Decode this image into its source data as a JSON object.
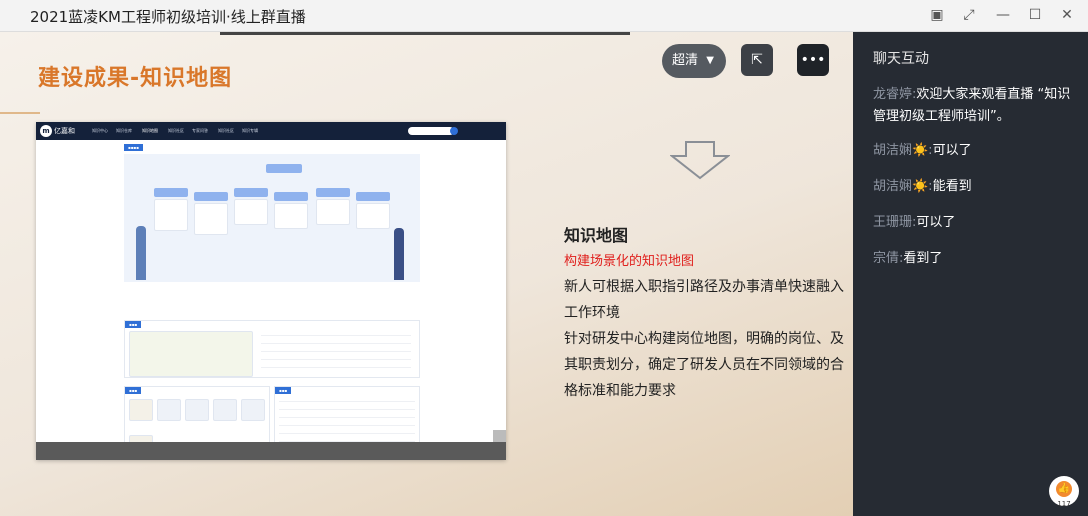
{
  "window": {
    "title": "2021蓝凌KM工程师初级培训·线上群直播",
    "controls": [
      "pip-icon",
      "fullscreen-icon",
      "minimize-icon",
      "maximize-icon",
      "close-icon"
    ]
  },
  "player": {
    "quality_label": "超清",
    "slide": {
      "title": "建设成果-知识地图",
      "heading": "知识地图",
      "subheading": "构建场景化的知识地图",
      "para1": "新人可根据入职指引路径及办事清单快速融入工作环境",
      "para2": "针对研发中心构建岗位地图，明确的岗位、及其职责划分，确定了研发人员在不同领域的合格标准和能力要求"
    },
    "embedded": {
      "logo": "亿嘉和",
      "menu": [
        "知识中心",
        "知识仓库",
        "知识地图",
        "知识社区",
        "专家问答",
        "知识社区",
        "知识专辑"
      ],
      "search_placeholder": "搜索一下"
    }
  },
  "chat": {
    "header": "聊天互动",
    "messages": [
      {
        "user": "龙睿婷:",
        "text": "欢迎大家来观看直播 “知识管理初级工程师培训”。"
      },
      {
        "user": "胡洁娴☀️:",
        "text": "可以了"
      },
      {
        "user": "胡洁娴☀️:",
        "text": "能看到"
      },
      {
        "user": "王珊珊:",
        "text": "可以了"
      },
      {
        "user": "宗倩:",
        "text": "看到了"
      }
    ],
    "like_count": "117"
  }
}
